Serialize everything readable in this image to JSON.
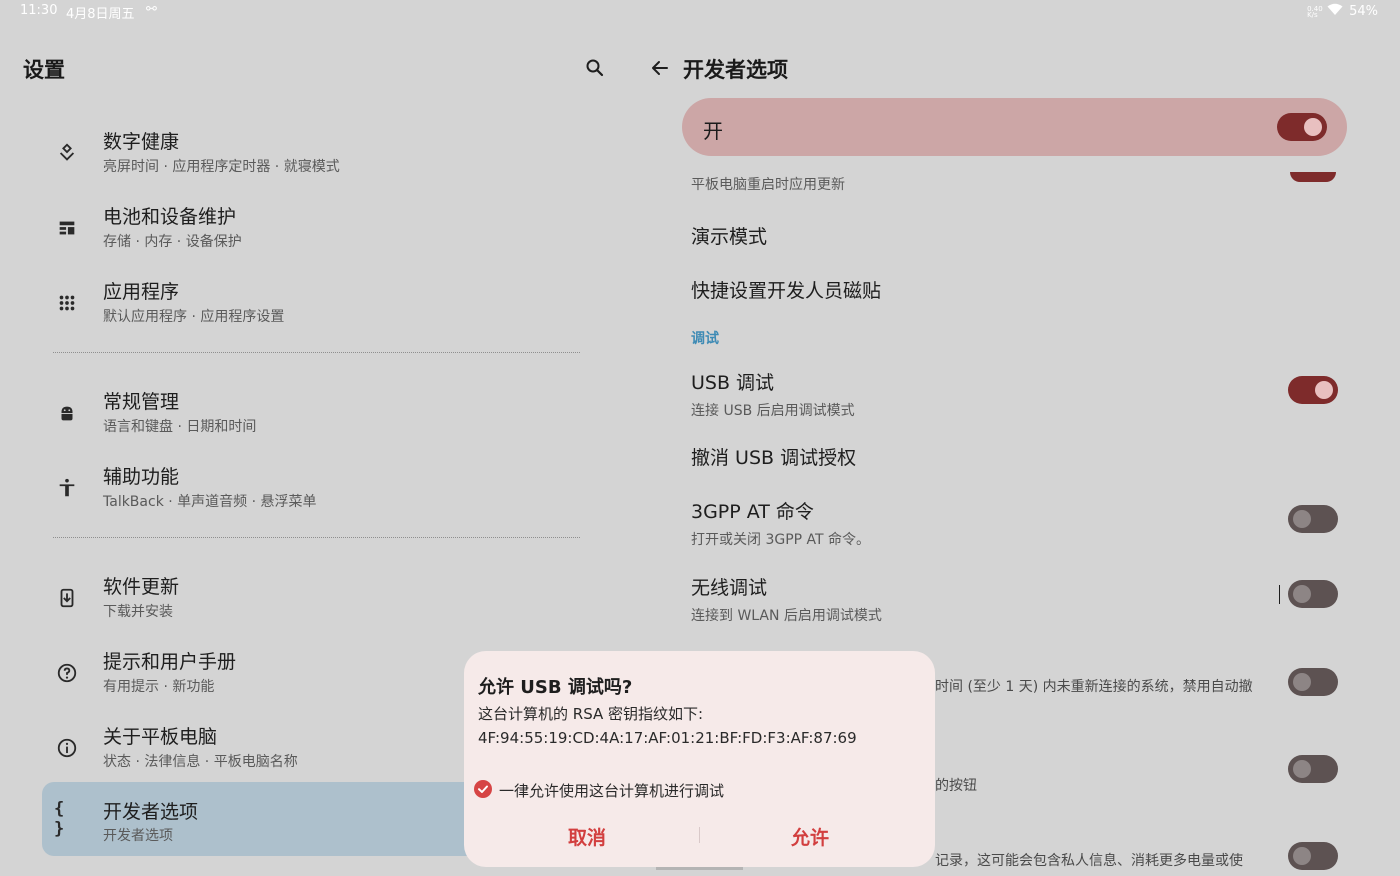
{
  "status_bar": {
    "time": "11:30",
    "date": "4月8日周五",
    "network_speed": "0.40 K/s",
    "battery": "54%"
  },
  "left_panel": {
    "title": "设置",
    "items": [
      {
        "title": "数字健康",
        "subtitle": "亮屏时间 · 应用程序定时器 · 就寝模式",
        "icon": "digital-wellbeing-icon"
      },
      {
        "title": "电池和设备维护",
        "subtitle": "存储 · 内存 · 设备保护",
        "icon": "device-care-icon"
      },
      {
        "title": "应用程序",
        "subtitle": "默认应用程序 · 应用程序设置",
        "icon": "apps-grid-icon"
      },
      {
        "title": "常规管理",
        "subtitle": "语言和键盘 · 日期和时间",
        "icon": "android-icon"
      },
      {
        "title": "辅助功能",
        "subtitle": "TalkBack · 单声道音频 · 悬浮菜单",
        "icon": "accessibility-icon"
      },
      {
        "title": "软件更新",
        "subtitle": "下载并安装",
        "icon": "software-update-icon"
      },
      {
        "title": "提示和用户手册",
        "subtitle": "有用提示 · 新功能",
        "icon": "help-icon"
      },
      {
        "title": "关于平板电脑",
        "subtitle": "状态 · 法律信息 · 平板电脑名称",
        "icon": "info-icon"
      },
      {
        "title": "开发者选项",
        "subtitle": "开发者选项",
        "icon": "braces-icon"
      }
    ]
  },
  "right_panel": {
    "title": "开发者选项",
    "master_switch_label": "开",
    "master_switch_on": true,
    "update_on_restart_subtitle": "平板电脑重启时应用更新",
    "demo_mode": "演示模式",
    "quick_tiles": "快捷设置开发人员磁贴",
    "category_debug": "调试",
    "usb_debugging": {
      "title": "USB 调试",
      "subtitle": "连接 USB 后启用调试模式",
      "on": true
    },
    "revoke_usb": "撤消 USB 调试授权",
    "gpp_at": {
      "title": "3GPP AT 命令",
      "subtitle": "打开或关闭 3GPP AT 命令。",
      "on": false
    },
    "wireless_debugging": {
      "title": "无线调试",
      "subtitle": "连接到 WLAN 后启用调试模式",
      "on": false
    },
    "partial_text_1": "时间 (至少 1 天) 内未重新连接的系统，禁用自动撤",
    "partial_text_2": "的按钮",
    "partial_text_3": "记录，这可能会包含私人信息、消耗更多电量或使"
  },
  "dialog": {
    "title": "允许 USB 调试吗?",
    "message": "这台计算机的 RSA 密钥指纹如下:",
    "fingerprint": "4F:94:55:19:CD:4A:17:AF:01:21:BF:FD:F3:AF:87:69",
    "checkbox_label": "一律允许使用这台计算机进行调试",
    "checkbox_checked": true,
    "cancel_label": "取消",
    "allow_label": "允许"
  },
  "colors": {
    "accent": "#7e2b2b",
    "dialog_button": "#d23f3f",
    "category": "#3e8bb5",
    "selected_item": "#adc0cc",
    "master_switch_bg": "#cca6a6"
  }
}
